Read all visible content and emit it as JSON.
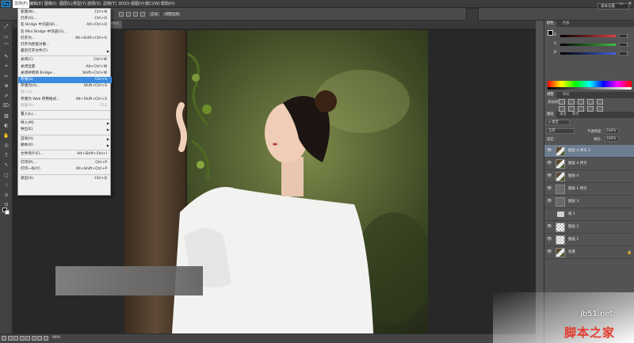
{
  "app": {
    "logo": "Ps"
  },
  "menubar": {
    "items": [
      "文件(F)",
      "编辑(E)",
      "图像(I)",
      "图层(L)",
      "类型(Y)",
      "选择(S)",
      "滤镜(T)",
      "3D(D)",
      "视图(V)",
      "窗口(W)",
      "帮助(H)"
    ],
    "window_controls": [
      "–",
      "▭",
      "✕"
    ]
  },
  "options_bar": {
    "buttons": [
      "自动",
      "调整边缘"
    ],
    "workspace": "基本功能"
  },
  "document": {
    "tab_label": "@ 99%",
    "zoom": "99%"
  },
  "file_menu": {
    "items": [
      {
        "label": "新建(N)...",
        "shortcut": "Ctrl+N"
      },
      {
        "label": "打开(O)...",
        "shortcut": "Ctrl+O"
      },
      {
        "label": "在 Bridge 中浏览(B)...",
        "shortcut": "Alt+Ctrl+O"
      },
      {
        "label": "在 Mini Bridge 中浏览(G)...",
        "shortcut": ""
      },
      {
        "label": "打开为...",
        "shortcut": "Alt+Shift+Ctrl+O"
      },
      {
        "label": "打开为智能对象...",
        "shortcut": ""
      },
      {
        "label": "最近打开文件(T)",
        "shortcut": "",
        "submenu": true
      },
      {
        "sep": true
      },
      {
        "label": "关闭(C)",
        "shortcut": "Ctrl+W"
      },
      {
        "label": "关闭全部",
        "shortcut": "Alt+Ctrl+W"
      },
      {
        "label": "关闭并转到 Bridge...",
        "shortcut": "Shift+Ctrl+W"
      },
      {
        "label": "存储(S)",
        "shortcut": "Ctrl+S",
        "highlight": true
      },
      {
        "label": "存储为(A)...",
        "shortcut": "Shift+Ctrl+S"
      },
      {
        "label": "签入(I)...",
        "shortcut": "",
        "disabled": true
      },
      {
        "label": "存储为 Web 所用格式...",
        "shortcut": "Alt+Shift+Ctrl+S"
      },
      {
        "label": "恢复(V)",
        "shortcut": "F12",
        "disabled": true
      },
      {
        "sep": true
      },
      {
        "label": "置入(L)...",
        "shortcut": ""
      },
      {
        "sep": true
      },
      {
        "label": "导入(M)",
        "shortcut": "",
        "submenu": true
      },
      {
        "label": "导出(E)",
        "shortcut": "",
        "submenu": true
      },
      {
        "sep": true
      },
      {
        "label": "自动(U)",
        "shortcut": "",
        "submenu": true
      },
      {
        "label": "脚本(R)",
        "shortcut": "",
        "submenu": true
      },
      {
        "sep": true
      },
      {
        "label": "文件简介(F)...",
        "shortcut": "Alt+Shift+Ctrl+I"
      },
      {
        "sep": true
      },
      {
        "label": "打印(P)...",
        "shortcut": "Ctrl+P"
      },
      {
        "label": "打印一份(Y)",
        "shortcut": "Alt+Shift+Ctrl+P"
      },
      {
        "sep": true
      },
      {
        "label": "退出(X)",
        "shortcut": "Ctrl+Q"
      }
    ]
  },
  "color_panel": {
    "tabs": [
      "颜色",
      "色板"
    ],
    "sliders": [
      {
        "letter": "R",
        "value": "0",
        "color": "#e04040"
      },
      {
        "letter": "G",
        "value": "0",
        "color": "#40c040"
      },
      {
        "letter": "B",
        "value": "0",
        "color": "#4060e0"
      }
    ]
  },
  "adjustments_panel": {
    "tabs": [
      "调整",
      "样式"
    ],
    "title": "添加调整"
  },
  "layers_panel": {
    "tabs": [
      "图层",
      "通道",
      "路径"
    ],
    "filter_label": "ρ 类型",
    "blend_mode": "正常",
    "opacity_label": "不透明度:",
    "opacity_value": "100%",
    "lock_label": "锁定:",
    "fill_label": "填充:",
    "fill_value": "100%",
    "layers": [
      {
        "name": "图层 4 拷贝 2",
        "selected": true,
        "thumb": "photo"
      },
      {
        "name": "图层 4 拷贝",
        "thumb": "photo"
      },
      {
        "name": "图层 4",
        "thumb": "photo"
      },
      {
        "name": "图层 1 拷贝",
        "thumb": "gray"
      },
      {
        "name": "图层 3",
        "thumb": "gray"
      },
      {
        "name": "组 1",
        "thumb": "folder",
        "hidden": true
      },
      {
        "name": "图层 2",
        "thumb": "check"
      },
      {
        "name": "图层 1",
        "thumb": "check"
      },
      {
        "name": "背景",
        "thumb": "photo",
        "locked": true
      }
    ]
  },
  "watermark": {
    "url": "jb51.net",
    "name": "脚本之家"
  }
}
